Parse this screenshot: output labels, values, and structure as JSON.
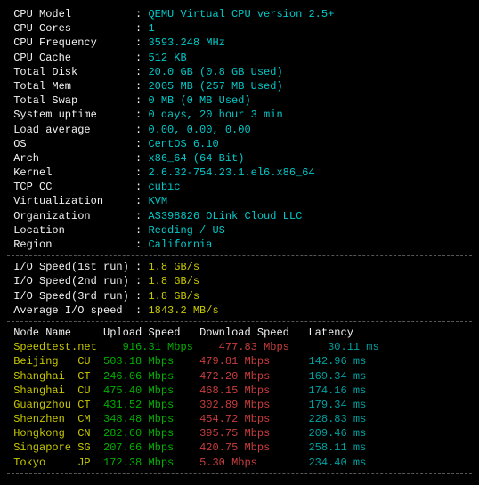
{
  "sys": [
    {
      "label": "CPU Model",
      "value": "QEMU Virtual CPU version 2.5+"
    },
    {
      "label": "CPU Cores",
      "value": "1"
    },
    {
      "label": "CPU Frequency",
      "value": "3593.248 MHz"
    },
    {
      "label": "CPU Cache",
      "value": "512 KB"
    },
    {
      "label": "Total Disk",
      "value": "20.0 GB (0.8 GB Used)"
    },
    {
      "label": "Total Mem",
      "value": "2005 MB (257 MB Used)"
    },
    {
      "label": "Total Swap",
      "value": "0 MB (0 MB Used)"
    },
    {
      "label": "System uptime",
      "value": "0 days, 20 hour 3 min"
    },
    {
      "label": "Load average",
      "value": "0.00, 0.00, 0.00"
    },
    {
      "label": "OS",
      "value": "CentOS 6.10"
    },
    {
      "label": "Arch",
      "value": "x86_64 (64 Bit)"
    },
    {
      "label": "Kernel",
      "value": "2.6.32-754.23.1.el6.x86_64"
    },
    {
      "label": "TCP CC",
      "value": "cubic"
    },
    {
      "label": "Virtualization",
      "value": "KVM"
    },
    {
      "label": "Organization",
      "value": "AS398826 OLink Cloud LLC"
    },
    {
      "label": "Location",
      "value": "Redding / US"
    },
    {
      "label": "Region",
      "value": "California"
    }
  ],
  "io": [
    {
      "label": "I/O Speed(1st run)",
      "value": "1.8 GB/s"
    },
    {
      "label": "I/O Speed(2nd run)",
      "value": "1.8 GB/s"
    },
    {
      "label": "I/O Speed(3rd run)",
      "value": "1.8 GB/s"
    },
    {
      "label": "Average I/O speed",
      "value": "1843.2 MB/s"
    }
  ],
  "speedHeader": {
    "node": "Node Name",
    "up": "Upload Speed",
    "down": "Download Speed",
    "lat": "Latency"
  },
  "speed": [
    {
      "name": "Speedtest.net",
      "tag": "",
      "up": "916.31 Mbps",
      "down": "477.83 Mbps",
      "lat": "30.11 ms"
    },
    {
      "name": "Beijing",
      "tag": "CU",
      "up": "503.18 Mbps",
      "down": "479.81 Mbps",
      "lat": "142.96 ms"
    },
    {
      "name": "Shanghai",
      "tag": "CT",
      "up": "246.06 Mbps",
      "down": "472.20 Mbps",
      "lat": "169.34 ms"
    },
    {
      "name": "Shanghai",
      "tag": "CU",
      "up": "475.40 Mbps",
      "down": "468.15 Mbps",
      "lat": "174.16 ms"
    },
    {
      "name": "Guangzhou",
      "tag": "CT",
      "up": "431.52 Mbps",
      "down": "302.89 Mbps",
      "lat": "179.34 ms"
    },
    {
      "name": "Shenzhen",
      "tag": "CM",
      "up": "348.48 Mbps",
      "down": "454.72 Mbps",
      "lat": "228.83 ms"
    },
    {
      "name": "Hongkong",
      "tag": "CN",
      "up": "282.60 Mbps",
      "down": "395.75 Mbps",
      "lat": "209.46 ms"
    },
    {
      "name": "Singapore",
      "tag": "SG",
      "up": "207.66 Mbps",
      "down": "420.75 Mbps",
      "lat": "258.11 ms"
    },
    {
      "name": "Tokyo",
      "tag": "JP",
      "up": "172.38 Mbps",
      "down": "5.30 Mbps",
      "lat": "234.40 ms"
    }
  ]
}
